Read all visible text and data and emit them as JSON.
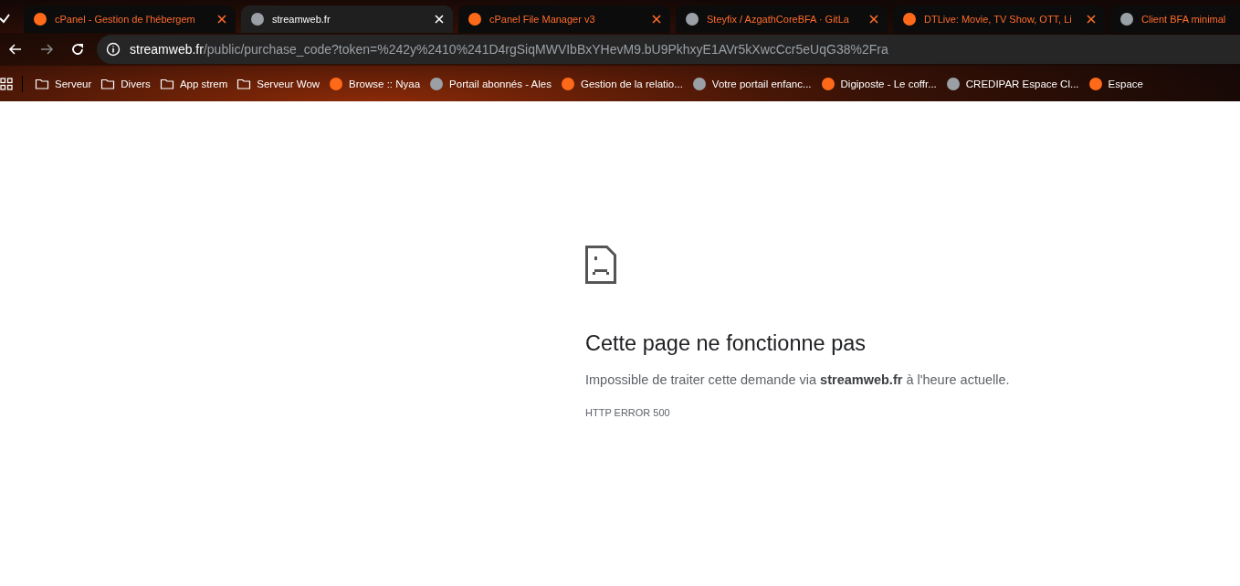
{
  "tabs": [
    {
      "title": "cPanel - Gestion de l'hébergem",
      "selected": false,
      "closable": true
    },
    {
      "title": "streamweb.fr",
      "selected": true,
      "closable": true
    },
    {
      "title": "cPanel File Manager v3",
      "selected": false,
      "closable": true
    },
    {
      "title": "Steyfix / AzgathCoreBFA · GitLa",
      "selected": false,
      "closable": true
    },
    {
      "title": "DTLive: Movie, TV Show, OTT, Li",
      "selected": false,
      "closable": true
    },
    {
      "title": "Client BFA minimal",
      "selected": false,
      "closable": false
    }
  ],
  "address_bar": {
    "host": "streamweb.fr",
    "path": "/public/purchase_code?token=%242y%2410%241D4rgSiqMWVIbBxYHevM9.bU9PkhxyE1AVr5kXwcCcr5eUqG38%2Fra"
  },
  "bookmarks": [
    {
      "kind": "folder",
      "label": "Serveur"
    },
    {
      "kind": "folder",
      "label": "Divers"
    },
    {
      "kind": "folder",
      "label": "App strem"
    },
    {
      "kind": "folder",
      "label": "Serveur Wow"
    },
    {
      "kind": "site",
      "label": "Browse :: Nyaa"
    },
    {
      "kind": "site",
      "label": "Portail abonnés - Ales"
    },
    {
      "kind": "site",
      "label": "Gestion de la relatio..."
    },
    {
      "kind": "site",
      "label": "Votre portail enfanc..."
    },
    {
      "kind": "site",
      "label": "Digiposte - Le coffr..."
    },
    {
      "kind": "site",
      "label": "CREDIPAR Espace Cl..."
    },
    {
      "kind": "site",
      "label": "Espace"
    }
  ],
  "error_page": {
    "heading": "Cette page ne fonctionne pas",
    "message": "Impossible de traiter cette demande via **streamweb.fr** à l'heure actuelle.",
    "error_code": "HTTP ERROR 500"
  }
}
